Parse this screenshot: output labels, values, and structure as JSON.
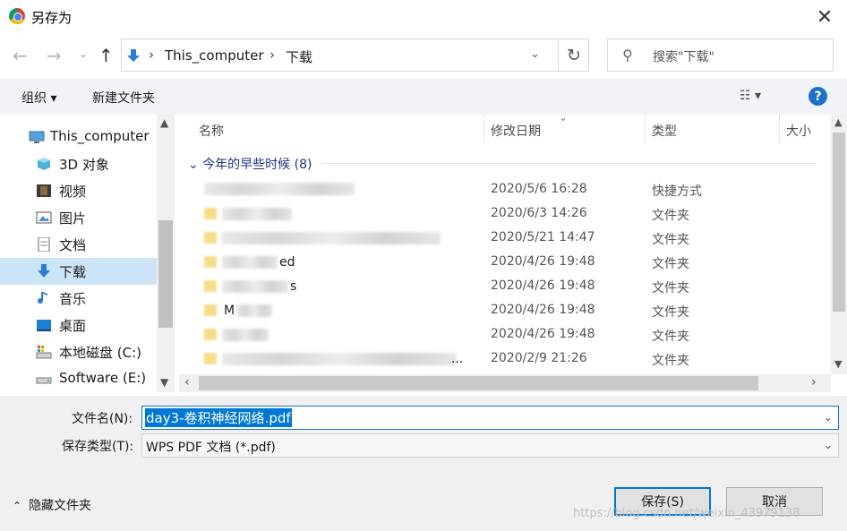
{
  "window": {
    "title": "另存为",
    "close": "✕"
  },
  "nav": {
    "back": "←",
    "forward": "→",
    "recent": "⌄",
    "up": "↑",
    "breadcrumb": [
      "This_computer",
      "下载"
    ],
    "separator": "›",
    "dropdown": "⌄",
    "refresh": "↻",
    "search_placeholder": "搜索\"下载\""
  },
  "toolbar": {
    "organize": "组织 ▾",
    "new_folder": "新建文件夹",
    "view": "☷ ▾",
    "help": "?"
  },
  "sidebar": {
    "items": [
      {
        "label": "This_computer",
        "icon": "computer-icon"
      },
      {
        "label": "3D 对象",
        "icon": "cube-icon"
      },
      {
        "label": "视频",
        "icon": "film-icon"
      },
      {
        "label": "图片",
        "icon": "picture-icon"
      },
      {
        "label": "文档",
        "icon": "document-icon"
      },
      {
        "label": "下载",
        "icon": "download-icon",
        "selected": true
      },
      {
        "label": "音乐",
        "icon": "music-icon"
      },
      {
        "label": "桌面",
        "icon": "desktop-icon"
      },
      {
        "label": "本地磁盘 (C:)",
        "icon": "drive-c-icon"
      },
      {
        "label": "Software (E:)",
        "icon": "drive-e-icon"
      }
    ]
  },
  "filelist": {
    "columns": [
      "名称",
      "修改日期",
      "类型",
      "大小"
    ],
    "group": "⌄ 今年的早些时候 (8)",
    "rows": [
      {
        "name_tail": "",
        "date": "2020/5/6 16:28",
        "type": "快捷方式"
      },
      {
        "name_tail": "",
        "date": "2020/6/3 14:26",
        "type": "文件夹"
      },
      {
        "name_tail": "",
        "date": "2020/5/21 14:47",
        "type": "文件夹"
      },
      {
        "name_tail": "ed",
        "date": "2020/4/26 19:48",
        "type": "文件夹"
      },
      {
        "name_tail": "s",
        "date": "2020/4/26 19:48",
        "type": "文件夹"
      },
      {
        "name_tail": "M",
        "date": "2020/4/26 19:48",
        "type": "文件夹"
      },
      {
        "name_tail": "",
        "date": "2020/4/26 19:48",
        "type": "文件夹"
      },
      {
        "name_tail": "...",
        "date": "2020/2/9 21:26",
        "type": "文件夹"
      }
    ]
  },
  "form": {
    "filename_label": "文件名(N):",
    "filename_value": "day3-卷积神经网络.pdf",
    "type_label": "保存类型(T):",
    "type_value": "WPS PDF 文档 (*.pdf)",
    "hide_folders": "隐藏文件夹",
    "save": "保存(S)",
    "cancel": "取消"
  },
  "watermark": "https://blog.csdn.net/weixin_43979138",
  "colors": {
    "accent": "#0078d7",
    "selected_bg": "#cce4f7",
    "toolbar_bg": "#f0f4f9"
  }
}
